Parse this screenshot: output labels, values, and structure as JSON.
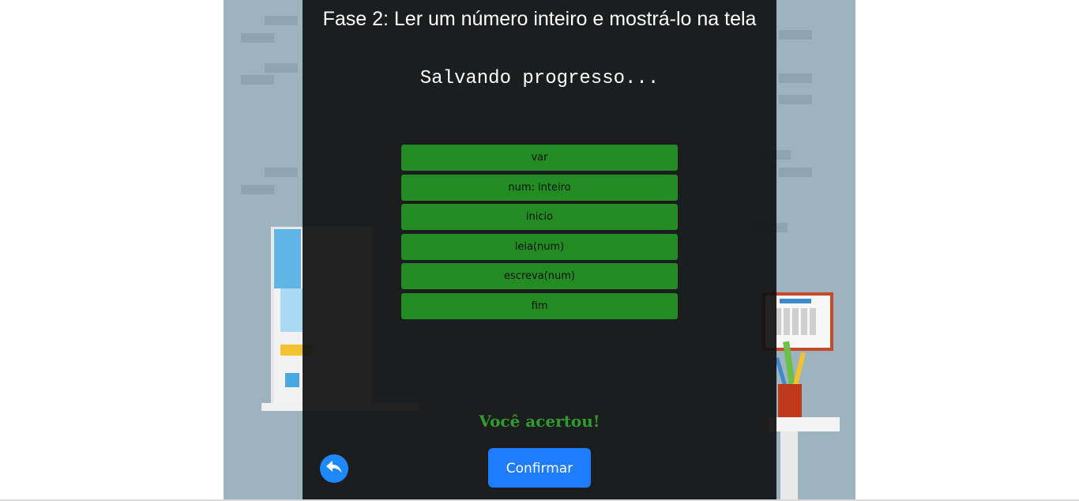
{
  "game": {
    "stage_title": "Fase 2: Ler um número inteiro e mostrá-lo na tela",
    "status": "Salvando progresso...",
    "code_lines": [
      "var",
      "num: inteiro",
      "inicio",
      "leia(num)",
      "escreva(num)",
      "fim"
    ],
    "result": "Você acertou!",
    "confirm_label": "Confirmar",
    "back_icon": "reply-arrow-icon"
  },
  "colors": {
    "code_block_bg": "#228b22",
    "result_text": "#2e9c2e",
    "button_blue": "#1e7cff",
    "panel_bg": "#111111",
    "scene_bg": "#9db3c0"
  }
}
